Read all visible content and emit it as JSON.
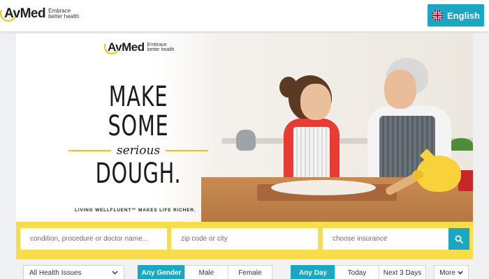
{
  "header": {
    "brand": "AvMed",
    "tagline_line1": "Embrace",
    "tagline_line2": "better health",
    "language_label": "English",
    "language_icon": "uk-flag-icon"
  },
  "hero": {
    "brand": "AvMed",
    "tagline_line1": "Embrace",
    "tagline_line2": "better health",
    "headline_line1": "MAKE SOME",
    "headline_line2": "serious",
    "headline_line3": "DOUGH.",
    "subline": "LIVING WELLFLUENT™ MAKES LIFE RICHER."
  },
  "search": {
    "condition_placeholder": "condition, procedure or doctor name...",
    "location_placeholder": "zip code or city",
    "insurance_placeholder": "choose insurance",
    "button_icon": "search-icon"
  },
  "filters": {
    "health_issue_selected": "All Health Issues",
    "gender_options": [
      "Any Gender",
      "Male",
      "Female"
    ],
    "gender_selected": "Any Gender",
    "day_options": [
      "Any Day",
      "Today",
      "Next 3 Days"
    ],
    "day_selected": "Any Day",
    "more_label": "More"
  },
  "colors": {
    "accent": "#1aa7c4",
    "search_bar": "#f8dc4a",
    "logo_arc": "#f2c500"
  }
}
